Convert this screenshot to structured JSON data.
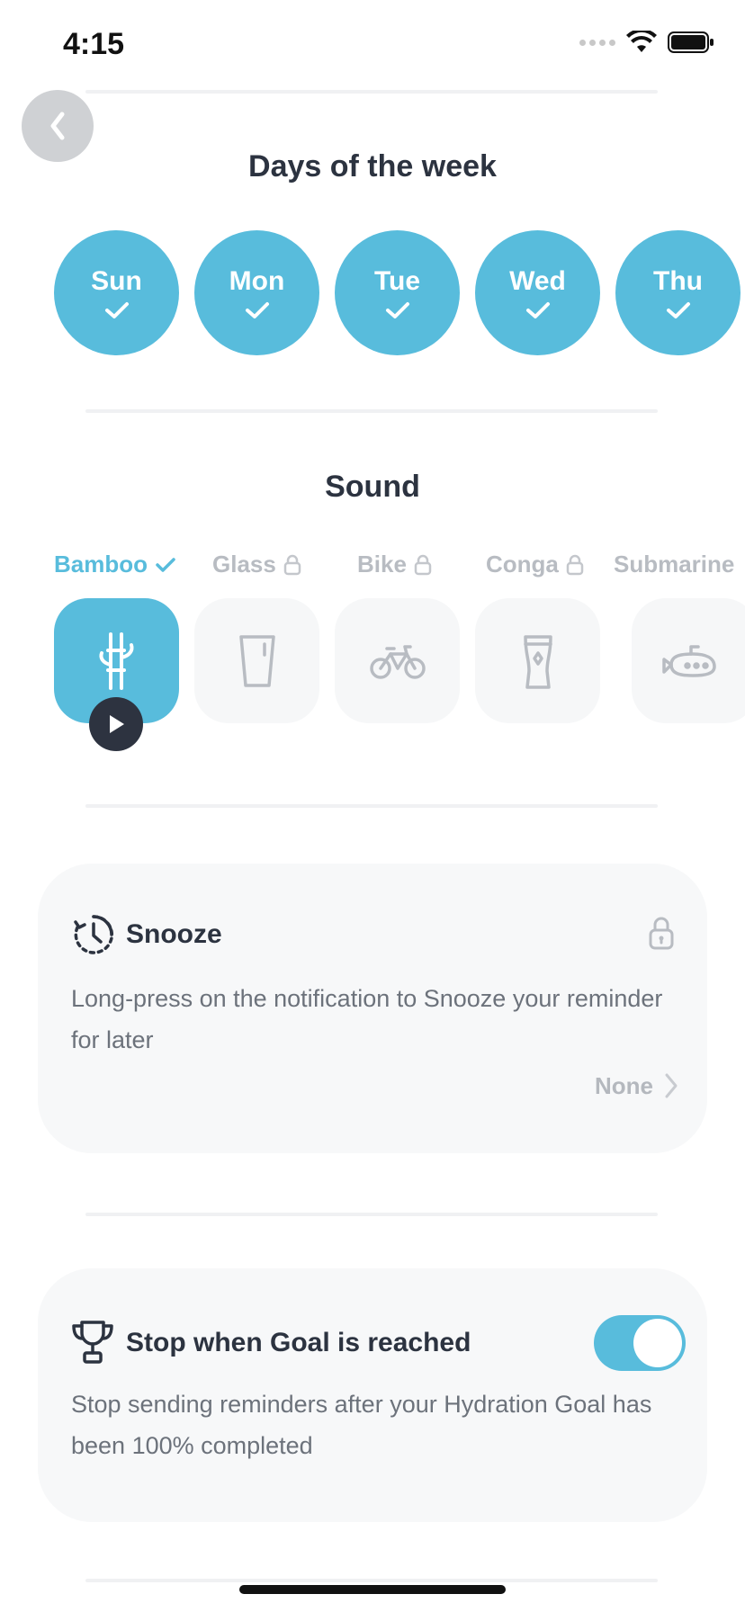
{
  "status_bar": {
    "time": "4:15"
  },
  "days_section": {
    "title": "Days of the week",
    "days": [
      {
        "label": "Sun",
        "selected": true
      },
      {
        "label": "Mon",
        "selected": true
      },
      {
        "label": "Tue",
        "selected": true
      },
      {
        "label": "Wed",
        "selected": true
      },
      {
        "label": "Thu",
        "selected": true
      }
    ]
  },
  "sound_section": {
    "title": "Sound",
    "sounds": [
      {
        "label": "Bamboo",
        "status": "selected",
        "icon": "bamboo-icon"
      },
      {
        "label": "Glass",
        "status": "locked",
        "icon": "glass-icon"
      },
      {
        "label": "Bike",
        "status": "locked",
        "icon": "bike-icon"
      },
      {
        "label": "Conga",
        "status": "locked",
        "icon": "conga-icon"
      },
      {
        "label": "Submarine",
        "status": "none",
        "icon": "submarine-icon"
      }
    ]
  },
  "snooze_card": {
    "title": "Snooze",
    "description": "Long-press on the notification to Snooze your reminder for later",
    "value": "None",
    "locked": true
  },
  "goal_card": {
    "title": "Stop when Goal is reached",
    "description": "Stop sending reminders after your Hydration Goal has been 100% completed",
    "toggle_on": true
  },
  "colors": {
    "accent": "#58bcdc",
    "text_dark": "#2c3340",
    "text_muted": "#6c727b",
    "card_bg": "#f7f8f9"
  }
}
